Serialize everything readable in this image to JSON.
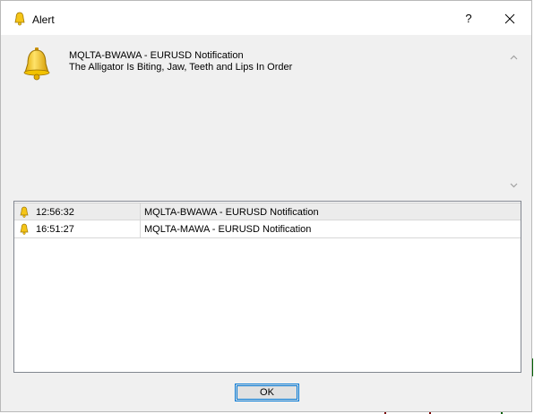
{
  "dialog": {
    "title": "Alert",
    "help_glyph": "?",
    "title_icon": "bell-icon",
    "close_icon": "close-icon"
  },
  "message": {
    "icon": "bell-icon",
    "line1": "MQLTA-BWAWA - EURUSD Notification",
    "line2": "The Alligator Is Biting, Jaw, Teeth and Lips In Order"
  },
  "alerts": [
    {
      "time": "12:56:32",
      "event": "MQLTA-BWAWA - EURUSD Notification",
      "selected": true
    },
    {
      "time": "16:51:27",
      "event": "MQLTA-MAWA - EURUSD Notification",
      "selected": false
    }
  ],
  "buttons": {
    "ok_label": "OK"
  },
  "colors": {
    "accent": "#0078d7",
    "bell": "#f5c518",
    "window_bg": "#f0f0f0"
  }
}
